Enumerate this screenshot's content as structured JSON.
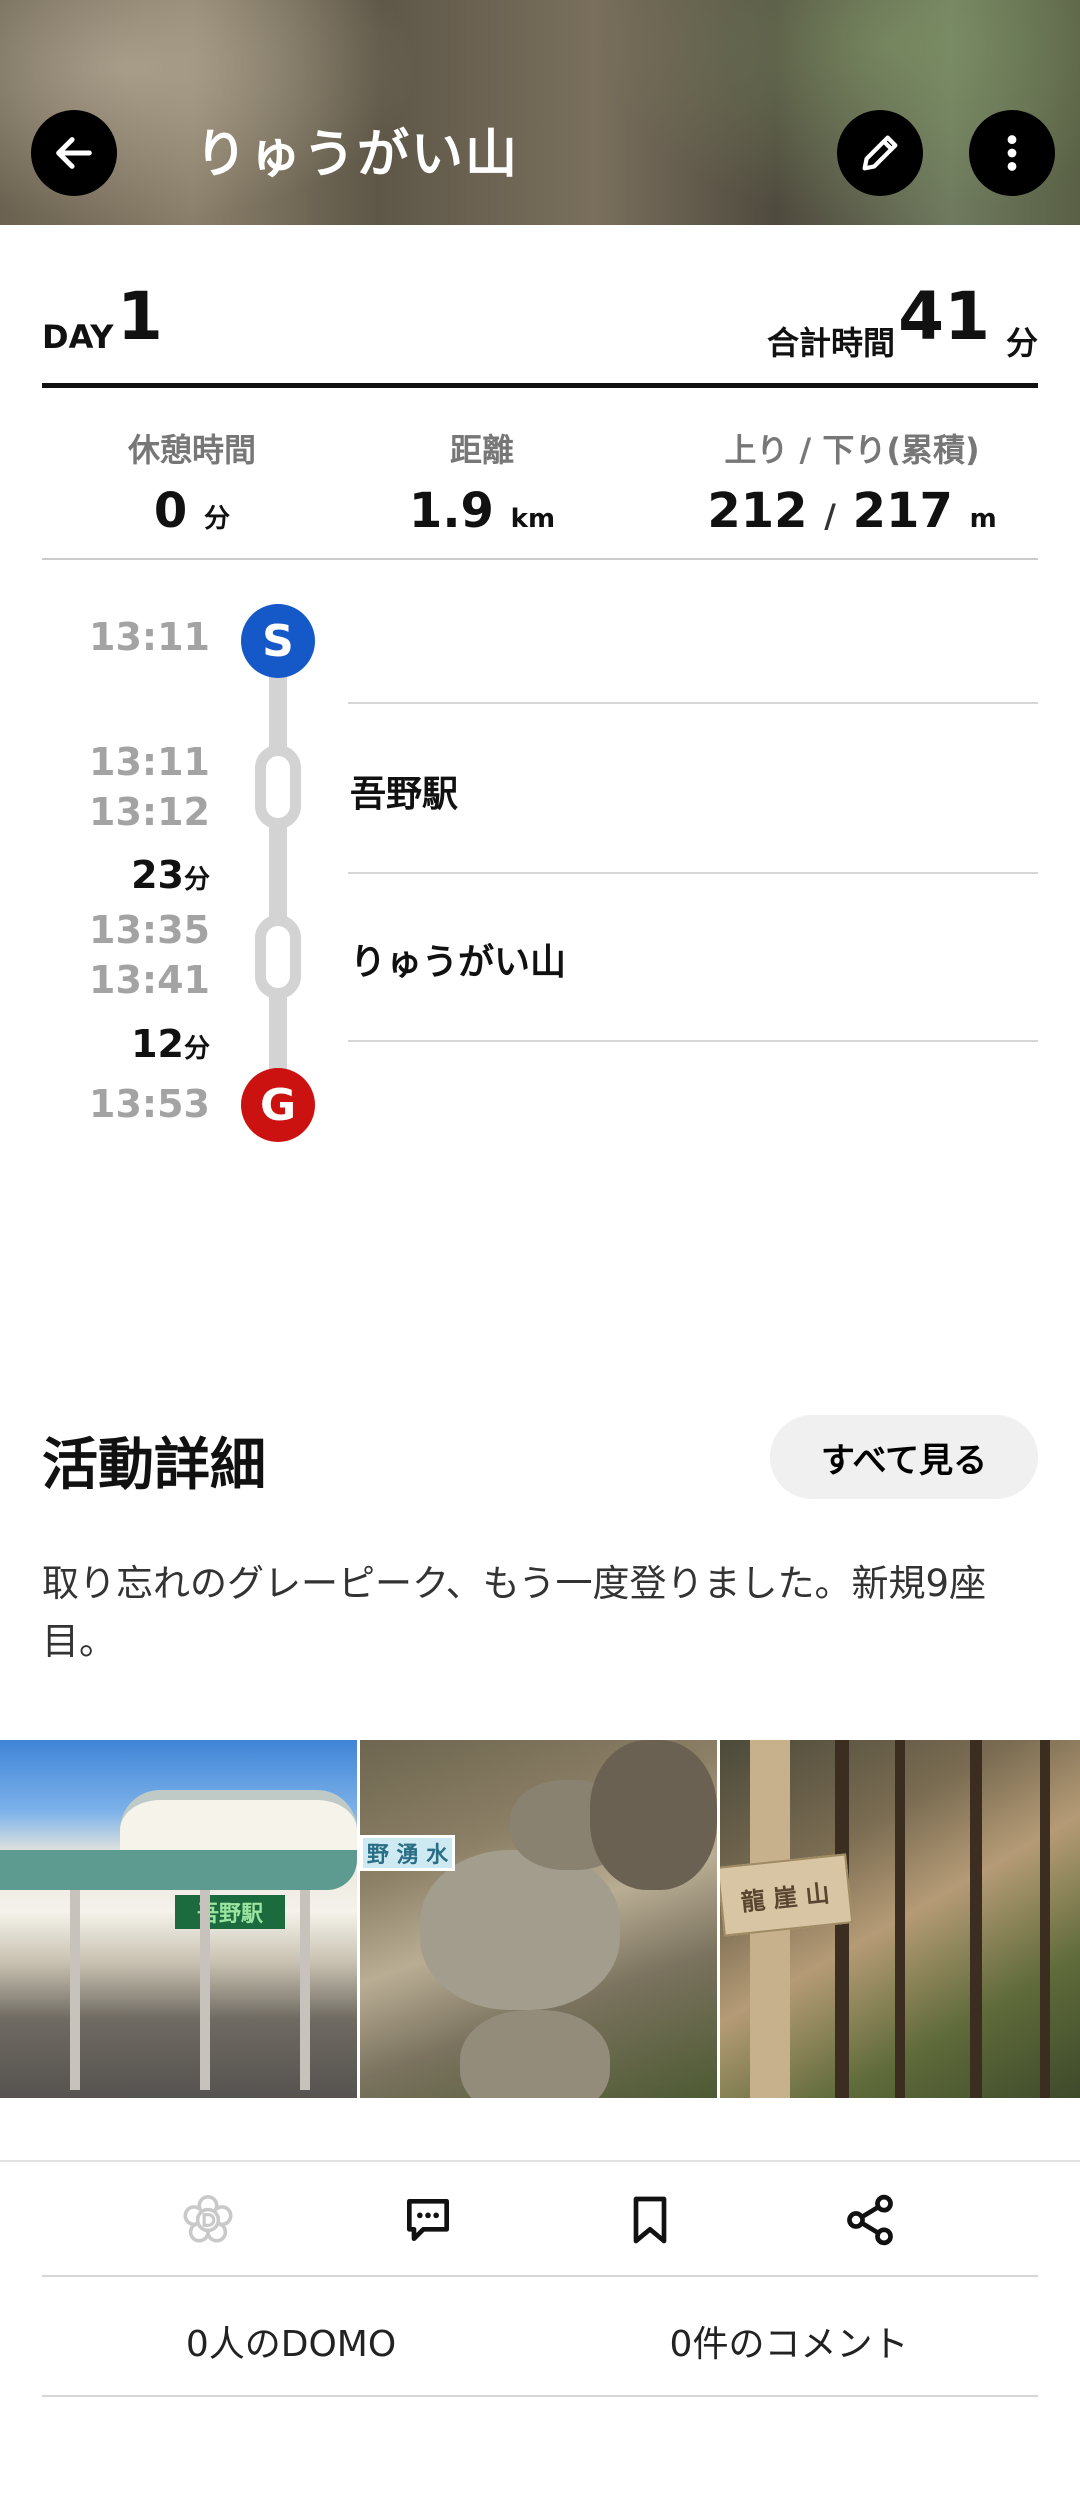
{
  "header": {
    "title": "りゅうがい山",
    "icons": [
      "back-arrow-icon",
      "pencil-icon",
      "more-vertical-icon"
    ]
  },
  "day": {
    "label": "DAY",
    "number": "1",
    "total_label": "合計時間",
    "total_value": "41",
    "total_unit": "分"
  },
  "stats": {
    "rest_label": "休憩時間",
    "rest_value": "0",
    "rest_unit": "分",
    "distance_label": "距離",
    "distance_value": "1.9",
    "distance_unit": "km",
    "elev_label": "上り / 下り(累積)",
    "elev_up": "212",
    "elev_sep": "/",
    "elev_down": "217",
    "elev_unit": "m"
  },
  "timeline": {
    "start_time": "13:11",
    "start_badge": "S",
    "p1_arrive": "13:11",
    "p1_depart": "13:12",
    "p1_name": "吾野駅",
    "seg1_duration": "23",
    "p2_arrive": "13:35",
    "p2_depart": "13:41",
    "p2_name": "りゅうがい山",
    "seg2_duration": "12",
    "duration_unit": "分",
    "goal_time": "13:53",
    "goal_badge": "G"
  },
  "activity": {
    "title": "活動詳細",
    "see_all": "すべて見る",
    "description": "取り忘れのグレーピーク、もう一度登りました。新規9座目。"
  },
  "photos": {
    "station_sign": "吾野駅",
    "spring_sign": "野 湧 水",
    "peak_sign": "龍 崖 山"
  },
  "footer": {
    "domo_count": "0人のDOMO",
    "comment_count": "0件のコメント",
    "icons": [
      "domo-flower-icon",
      "comment-icon",
      "bookmark-icon",
      "share-icon"
    ]
  },
  "colors": {
    "start": "#1558c7",
    "goal": "#cc1111",
    "timeline": "#d3d3d3"
  }
}
